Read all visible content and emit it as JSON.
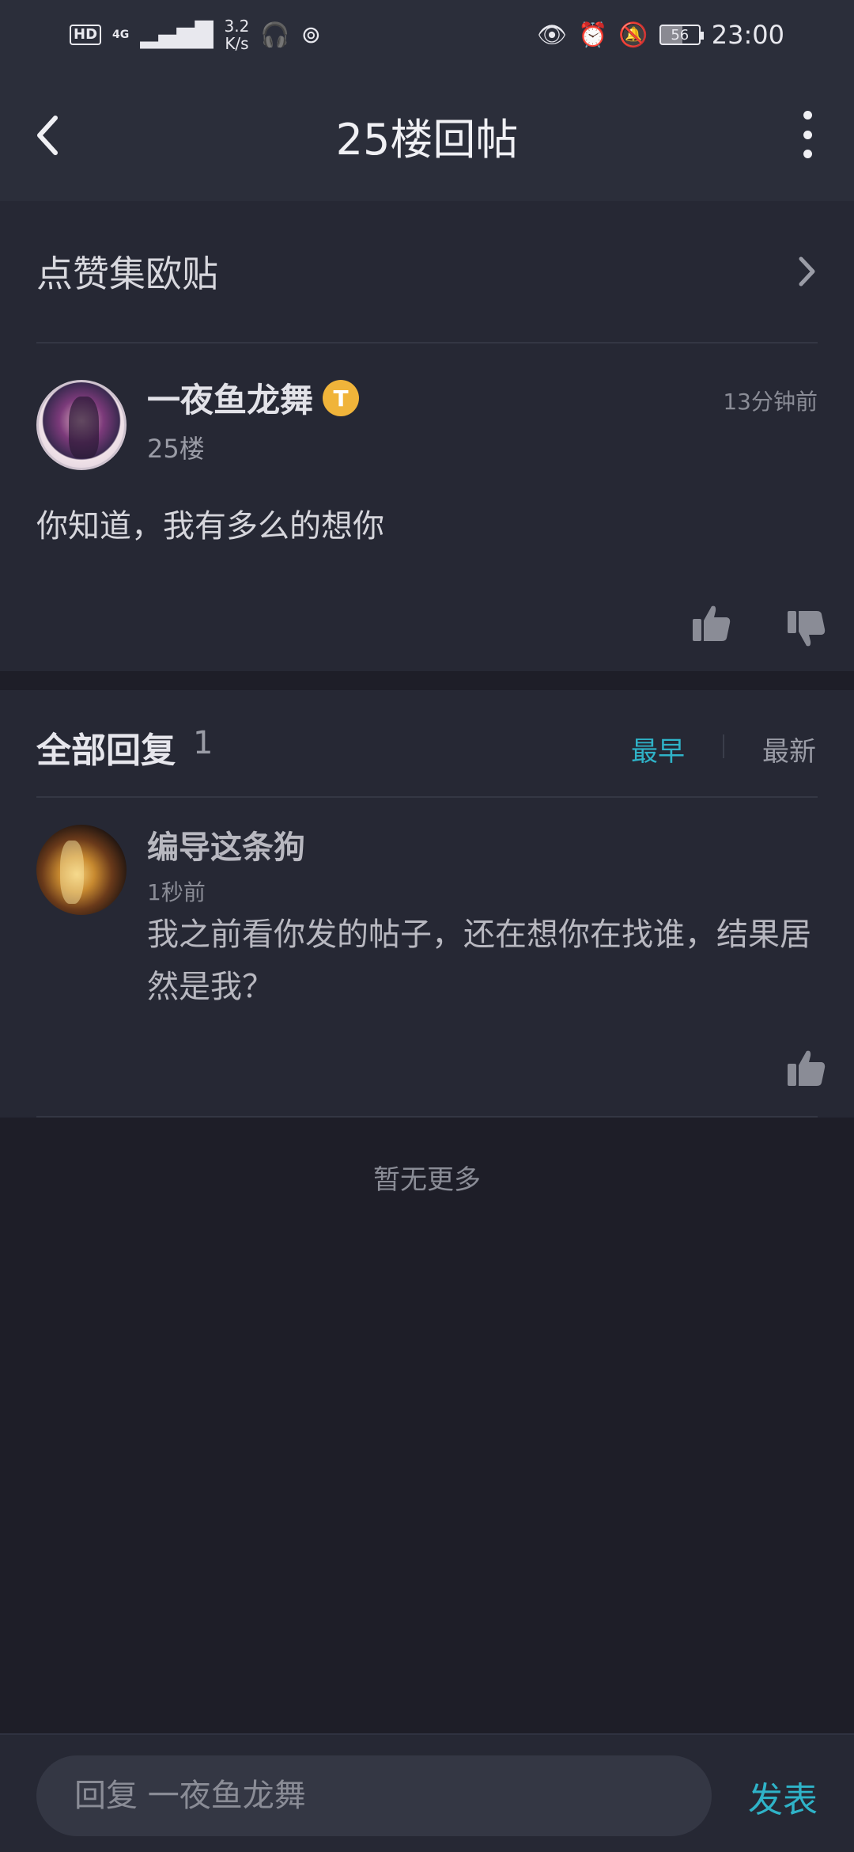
{
  "status_bar": {
    "hd": "HD",
    "network": "4G",
    "speed_value": "3.2",
    "speed_unit": "K/s",
    "battery": "56",
    "time": "23:00"
  },
  "nav": {
    "title": "25楼回帖"
  },
  "entry": {
    "label": "点赞集欧贴"
  },
  "post": {
    "author": "一夜鱼龙舞",
    "badge": "T",
    "floor": "25楼",
    "time": "13分钟前",
    "content": "你知道，我有多么的想你"
  },
  "replies": {
    "title": "全部回复",
    "count": "1",
    "sort_earliest": "最早",
    "sort_latest": "最新",
    "items": [
      {
        "author": "编导这条狗",
        "time": "1秒前",
        "content": "我之前看你发的帖子，还在想你在找谁，结果居然是我？"
      }
    ],
    "no_more": "暂无更多"
  },
  "bottom_bar": {
    "placeholder": "回复 一夜鱼龙舞",
    "send_label": "发表"
  },
  "colors": {
    "accent": "#2fb3c8",
    "background": "#1e1e28",
    "panel": "#262834"
  }
}
